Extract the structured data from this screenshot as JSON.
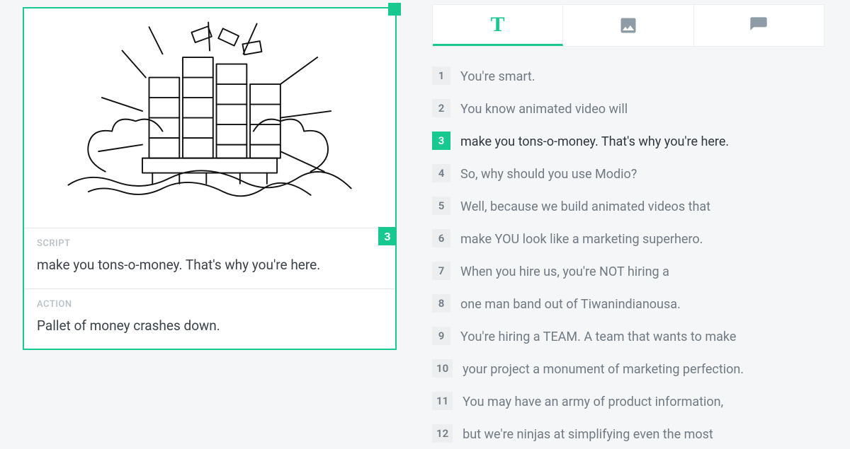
{
  "card": {
    "frame_number": "3",
    "script_label": "SCRIPT",
    "script_body": "make you tons-o-money. That's why you're here.",
    "action_label": "ACTION",
    "action_body": "Pallet of money crashes down."
  },
  "tabs": {
    "text_glyph": "T"
  },
  "list": {
    "selected_index": 2,
    "items": [
      {
        "n": "1",
        "t": "You're smart."
      },
      {
        "n": "2",
        "t": "You know animated video will"
      },
      {
        "n": "3",
        "t": "make you tons-o-money. That's why you're here."
      },
      {
        "n": "4",
        "t": "So, why should you use Modio?"
      },
      {
        "n": "5",
        "t": "Well, because we build animated videos that"
      },
      {
        "n": "6",
        "t": "make YOU look like a marketing superhero."
      },
      {
        "n": "7",
        "t": "When you hire us, you're NOT hiring a"
      },
      {
        "n": "8",
        "t": "one man band out of Tiwanindianousa."
      },
      {
        "n": "9",
        "t": "You're hiring a TEAM. A team that wants to make"
      },
      {
        "n": "10",
        "t": "your project a monument of marketing perfection."
      },
      {
        "n": "11",
        "t": "You may have an army of product information,"
      },
      {
        "n": "12",
        "t": "but we're ninjas at simplifying even the most"
      }
    ]
  }
}
